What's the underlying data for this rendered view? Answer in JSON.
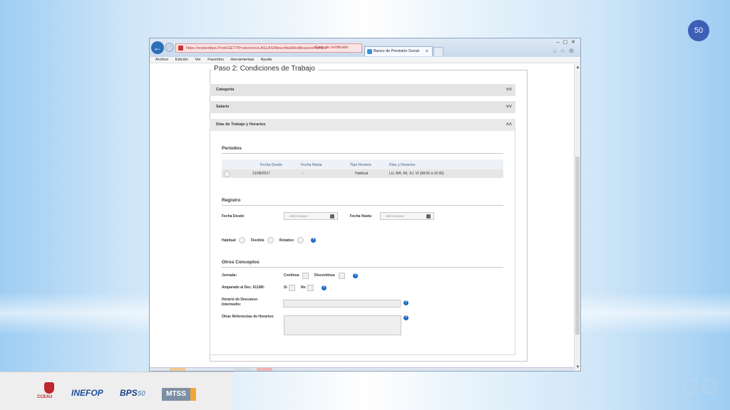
{
  "slide": {
    "page_number": "50",
    "prev_icon": "chevron-left-icon",
    "next_icon": "chevron-right-icon"
  },
  "footer_logos": [
    "CCEAU",
    "INEFOP",
    "BPS",
    "MTSS"
  ],
  "browser": {
    "url": "https://scptestbps.ProtoGE77/ProtectoresLASLAS/Meschfe&ModificacionPerfiles",
    "cert_error": "Error de certificado",
    "tab_title": "Banco de Previsión Social",
    "menu": [
      "Archivo",
      "Edición",
      "Ver",
      "Favoritos",
      "Herramientas",
      "Ayuda"
    ]
  },
  "form": {
    "step_title": "Paso 2: Condiciones de Trabajo",
    "accordions": [
      {
        "label": "Categoría",
        "state": "collapsed"
      },
      {
        "label": "Salario",
        "state": "collapsed"
      },
      {
        "label": "Días de Trabajo y Horarios",
        "state": "expanded"
      }
    ],
    "periodos": {
      "title": "Períodos",
      "headers": [
        "Fecha Desde",
        "Fecha Hasta",
        "Tipo Horario",
        "Días y Horarios"
      ],
      "rows": [
        {
          "desde": "21/08/2017",
          "hasta": "-",
          "tipo": "Habitual",
          "dias": "LU, MA, MI, JU, VI (08:00 a 16:00)"
        }
      ]
    },
    "registro": {
      "title": "Registro",
      "fecha_desde_label": "Fecha Desde:",
      "fecha_hasta_label": "Fecha Hasta:",
      "date_placeholder": "dd/mm/aaaa",
      "options": [
        "Habitual",
        "Flexible",
        "Rotativo"
      ]
    },
    "otros": {
      "title": "Otros Conceptos",
      "jornada_label": "Jornada:",
      "continua": "Continua",
      "discontinua": "Discontinua",
      "amparado_label": "Amparado al Dec. 611/80:",
      "si": "Sí",
      "no": "No",
      "descanso_label": "Horario de Descanso Intermedio:",
      "referencias_label": "Otras Referencias de Horarios:"
    }
  },
  "colors": {
    "accent": "#3d5fb5",
    "help": "#1a68c4"
  }
}
